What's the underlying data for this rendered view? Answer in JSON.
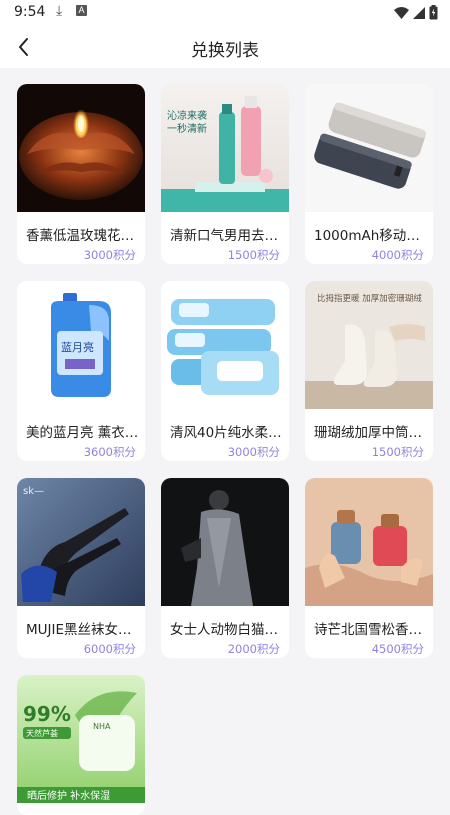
{
  "status_bar": {
    "time": "9:54",
    "a_badge": "A"
  },
  "header": {
    "title": "兑换列表"
  },
  "colors": {
    "points": "#8e84e0",
    "card_bg": "#ffffff",
    "page_bg": "#f4f4f6"
  },
  "items": [
    {
      "name": "香薰低温玫瑰花…",
      "points": "3000积分"
    },
    {
      "name": "清新口气男用去…",
      "points": "1500积分"
    },
    {
      "name": "1000mAh移动电…",
      "points": "4000积分"
    },
    {
      "name": "美的蓝月亮 薰衣…",
      "points": "3600积分"
    },
    {
      "name": "清风40片纯水柔…",
      "points": "3000积分"
    },
    {
      "name": "珊瑚绒加厚中筒…",
      "points": "1500积分"
    },
    {
      "name": "MUJIE黑丝袜女…",
      "points": "6000积分"
    },
    {
      "name": "女士人动物白猫…",
      "points": "2000积分"
    },
    {
      "name": "诗芒北国雪松香…",
      "points": "4500积分"
    },
    {
      "name": "",
      "points": ""
    }
  ],
  "image_text": {
    "spray_line1": "沁凉来袭",
    "spray_line2": "一秒清新",
    "sock_caption": "比拇指更暖  加厚加密珊瑚绒",
    "sk_logo": "sk—",
    "detergent": "蓝月亮",
    "aloe_pct": "99%",
    "aloe_sub": "天然芦荟",
    "aloe_bottom": "晒后修护 补水保湿",
    "aloe_brand": "NHA"
  }
}
